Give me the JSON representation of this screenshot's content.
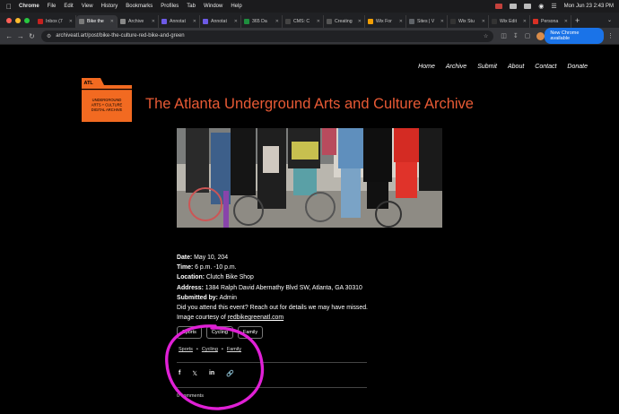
{
  "menubar": {
    "app": "Chrome",
    "items": [
      "File",
      "Edit",
      "View",
      "History",
      "Bookmarks",
      "Profiles",
      "Tab",
      "Window",
      "Help"
    ],
    "datetime": "Mon Jun 23  2:43 PM"
  },
  "tabs": [
    {
      "label": "Inbox (7",
      "color": "#c5221f"
    },
    {
      "label": "Bike the",
      "color": "#7a7a7a",
      "active": true
    },
    {
      "label": "Archive",
      "color": "#888888"
    },
    {
      "label": "Annotat",
      "color": "#6d5ae6"
    },
    {
      "label": "Annotat",
      "color": "#6d5ae6"
    },
    {
      "label": "365 Da",
      "color": "#1e8e3e"
    },
    {
      "label": "CMS: C",
      "color": "#444444"
    },
    {
      "label": "Creating",
      "color": "#555555"
    },
    {
      "label": "Wix For",
      "color": "#f29f05"
    },
    {
      "label": "Sites | V",
      "color": "#5f6368"
    },
    {
      "label": "Wix Stu",
      "color": "#333333"
    },
    {
      "label": "Wix Edit",
      "color": "#333333"
    },
    {
      "label": "Persona",
      "color": "#d93025"
    }
  ],
  "address": {
    "url": "archiveatl.art/post/bike-the-culture-red-bike-and-green",
    "new_chrome": "New Chrome available"
  },
  "site": {
    "nav": [
      "Home",
      "Archive",
      "Submit",
      "About",
      "Contact",
      "Donate"
    ],
    "title": "The Atlanta Underground Arts and Culture Archive",
    "logo": {
      "atl": "ATL",
      "line1": "UNDERGROUND",
      "line2": "ARTS + CULTURE",
      "line3": "DIGITAL ARCHIVE",
      "color": "#f26a21"
    }
  },
  "post": {
    "date_label": "Date:",
    "date": " May 10, 204",
    "time_label": "Time:",
    "time": " 6 p.m.  -10 p.m.",
    "location_label": "Location:",
    "location": " Clutch Bike Shop",
    "address_label": "Address:",
    "address": " 1384 Ralph David Abernathy Blvd SW, Atlanta, GA 30310",
    "submitted_label": "Submitted by:",
    "submitted": " Admin",
    "note": "Did you attend this event? Reach out for details we may have missed.",
    "credit_prefix": "Image courtesy of ",
    "credit_link": "redbikegreenatl.com",
    "tags": [
      "Sports",
      "Cycling",
      "Family"
    ],
    "categories": [
      "Sports",
      "Cycling",
      "Family"
    ],
    "comments": "0 comments"
  },
  "annotation_color": "#e020d6"
}
